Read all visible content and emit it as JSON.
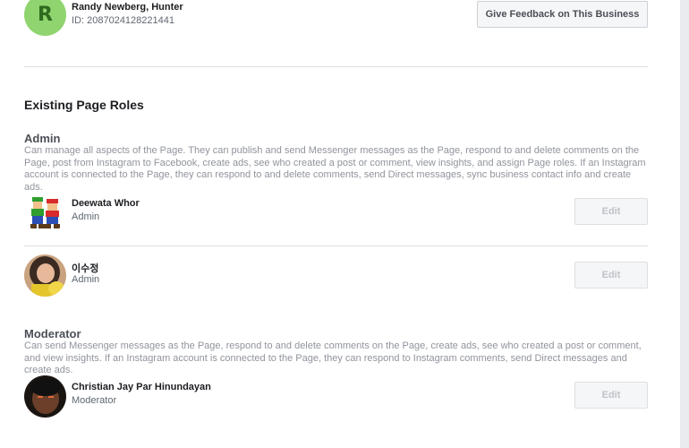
{
  "current_user": {
    "avatar_letter": "R",
    "name": "Randy Newberg, Hunter",
    "id_text": "ID: 2087024128221441",
    "feedback_button": "Give Feedback on This Business"
  },
  "existing_roles": {
    "title": "Existing Page Roles",
    "admin": {
      "heading": "Admin",
      "description": "Can manage all aspects of the Page. They can publish and send Messenger messages as the Page, respond to and delete comments on the Page, post from Instagram to Facebook, create ads, see who created a post or comment, view insights, and assign Page roles. If an Instagram account is connected to the Page, they can respond to and delete comments, send Direct messages, sync business contact info and create ads.",
      "people": [
        {
          "name": "Deewata Whor",
          "role": "Admin",
          "edit_label": "Edit"
        },
        {
          "name": "이수정",
          "role": "Admin",
          "edit_label": "Edit"
        }
      ]
    },
    "moderator": {
      "heading": "Moderator",
      "description": "Can send Messenger messages as the Page, respond to and delete comments on the Page, create ads, see who created a post or comment, and view insights. If an Instagram account is connected to the Page, they can respond to Instagram comments, send Direct messages and create ads.",
      "people": [
        {
          "name": "Christian Jay Par Hinundayan",
          "role": "Moderator",
          "edit_label": "Edit"
        }
      ]
    }
  },
  "colors": {
    "avatar_green": "#8fd46e",
    "muted_text": "#90949c",
    "disabled_button_text": "#bec3c9"
  }
}
